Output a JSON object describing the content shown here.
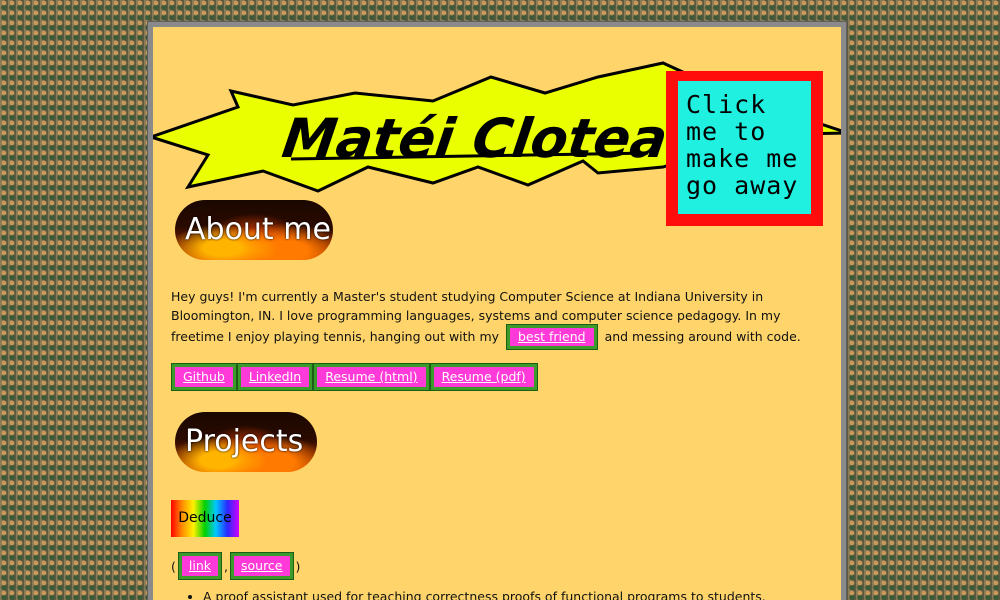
{
  "header": {
    "name": "Matéi Cloteaux",
    "go_away_text": "Click me to make me go away"
  },
  "about": {
    "heading": "About me",
    "intro_before": "Hey guys! I'm currently a Master's student studying Computer Science at Indiana University in Bloomington, IN. I love programming languages, systems and computer science pedagogy. In my freetime I enjoy playing tennis, hanging out with my",
    "best_friend_label": "best friend",
    "intro_after": "and messing around with code.",
    "links": [
      {
        "label": "Github"
      },
      {
        "label": "LinkedIn"
      },
      {
        "label": "Resume (html)"
      },
      {
        "label": "Resume (pdf)"
      }
    ]
  },
  "projects": {
    "heading": "Projects",
    "items": [
      {
        "name": "Deduce",
        "open_paren": "(",
        "separator": ",",
        "close_paren": ")",
        "link_label": "link",
        "source_label": "source",
        "description": "A proof assistant used for teaching correctness proofs of functional programs to students."
      }
    ]
  },
  "colors": {
    "page_bg": "#ffd56b",
    "button_bg": "#ff3ad8",
    "button_border": "#3a9a2a",
    "go_away_border": "#ff0c0c",
    "go_away_fill": "#1ff0e0",
    "banner_fill": "#eaff00"
  }
}
